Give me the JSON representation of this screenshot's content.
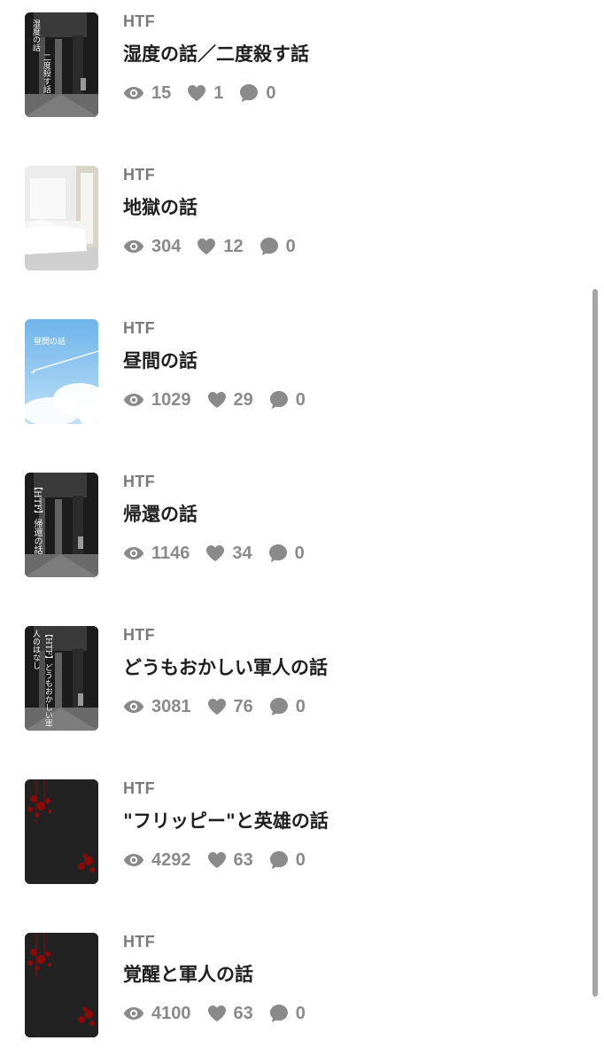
{
  "stories": [
    {
      "category": "HTF",
      "title": "湿度の話／二度殺す話",
      "views": "15",
      "likes": "1",
      "comments": "0",
      "cover_type": "dark-corridor",
      "cover_lines": [
        "湿度の話",
        "二度殺す話"
      ]
    },
    {
      "category": "HTF",
      "title": "地獄の話",
      "views": "304",
      "likes": "12",
      "comments": "0",
      "cover_type": "white-bedroom",
      "cover_lines": []
    },
    {
      "category": "HTF",
      "title": "昼間の話",
      "views": "1029",
      "likes": "29",
      "comments": "0",
      "cover_type": "blue-sky",
      "cover_lines": [
        "昼間の話"
      ]
    },
    {
      "category": "HTF",
      "title": "帰還の話",
      "views": "1146",
      "likes": "34",
      "comments": "0",
      "cover_type": "dark-corridor",
      "cover_lines": [
        "【HTF】帰還の話"
      ]
    },
    {
      "category": "HTF",
      "title": "どうもおかしい軍人の話",
      "views": "3081",
      "likes": "76",
      "comments": "0",
      "cover_type": "dark-corridor",
      "cover_lines": [
        "【HTF】どうもおかしい軍",
        "人のはなし"
      ]
    },
    {
      "category": "HTF",
      "title": "\"フリッピー\"と英雄の話",
      "views": "4292",
      "likes": "63",
      "comments": "0",
      "cover_type": "blood-dark",
      "cover_lines": []
    },
    {
      "category": "HTF",
      "title": "覚醒と軍人の話",
      "views": "4100",
      "likes": "63",
      "comments": "0",
      "cover_type": "blood-dark",
      "cover_lines": []
    }
  ],
  "icons": {
    "views": "eye-icon",
    "likes": "heart-icon",
    "comments": "speech-bubble-icon"
  },
  "colors": {
    "background": "#ffffff",
    "title": "#1f1f1f",
    "category": "#7a7a7a",
    "stats": "#8a8a8a",
    "scrollbar": "#a6a6a6",
    "blood": "#8b0a0a"
  }
}
